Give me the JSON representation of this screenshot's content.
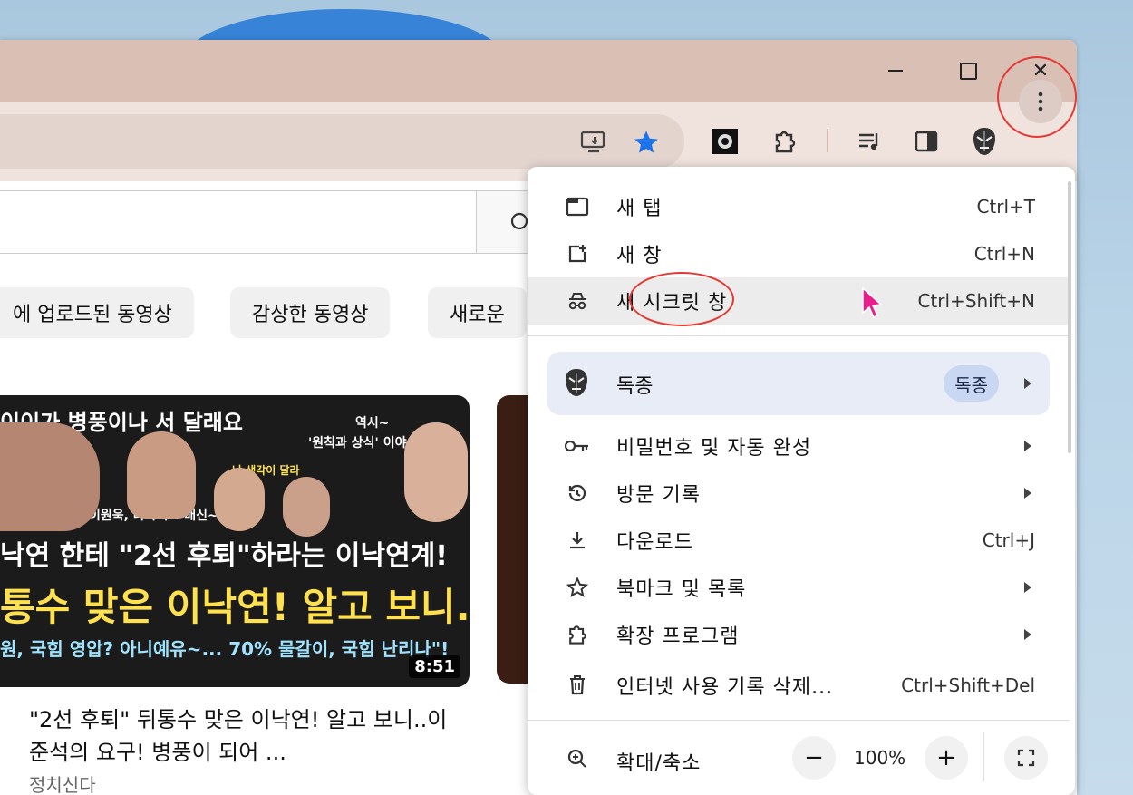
{
  "window": {
    "min_icon": "minimize-icon",
    "max_icon": "maximize-icon",
    "close_label": "✕"
  },
  "toolbar": {
    "icons": [
      "install-app-icon",
      "bookmark-star-icon",
      "extension-app-icon",
      "extensions-puzzle-icon",
      "media-queue-icon",
      "side-panel-icon",
      "profile-avatar-icon",
      "more-menu-icon"
    ],
    "accent": "#1a73e8"
  },
  "page": {
    "chips": [
      "에 업로드된 동영상",
      "감상한 동영상",
      "새로운 "
    ],
    "video": {
      "thumb_lines": [
        "이이가 병풍이나 서 달래요",
        "역시~",
        "'원칙과 상식' 이야~",
        "난 생각이 달라",
        "이원욱, 나가서도 배신~",
        "낙연 한테 \"2선 후퇴\"하라는 이낙연계!",
        "통수 맞은 이낙연! 알고 보니...",
        "원, 국힘 영압? 아니예유~... 70% 물갈이, 국힘 난리나\"!"
      ],
      "duration": "8:51",
      "title": "\"2선 후퇴\" 뒤통수 맞은 이낙연! 알고 보니..이준석의 요구! 병풍이 되어 ...",
      "channel": "정치신다"
    }
  },
  "menu": {
    "items": [
      {
        "label": "새 탭",
        "shortcut": "Ctrl+T"
      },
      {
        "label": "새 창",
        "shortcut": "Ctrl+N"
      },
      {
        "label": "새 시크릿 창",
        "shortcut": "Ctrl+Shift+N"
      }
    ],
    "profile": {
      "name": "독종",
      "badge": "독종"
    },
    "sub_items": [
      {
        "label": "비밀번호 및 자동 완성",
        "shortcut": ""
      },
      {
        "label": "방문 기록",
        "shortcut": ""
      },
      {
        "label": "다운로드",
        "shortcut": "Ctrl+J"
      },
      {
        "label": "북마크 및 목록",
        "shortcut": ""
      },
      {
        "label": "확장 프로그램",
        "shortcut": ""
      },
      {
        "label": "인터넷 사용 기록 삭제...",
        "shortcut": "Ctrl+Shift+Del"
      }
    ],
    "zoom": {
      "label": "확대/축소",
      "minus": "−",
      "value": "100%",
      "plus": "+"
    }
  }
}
